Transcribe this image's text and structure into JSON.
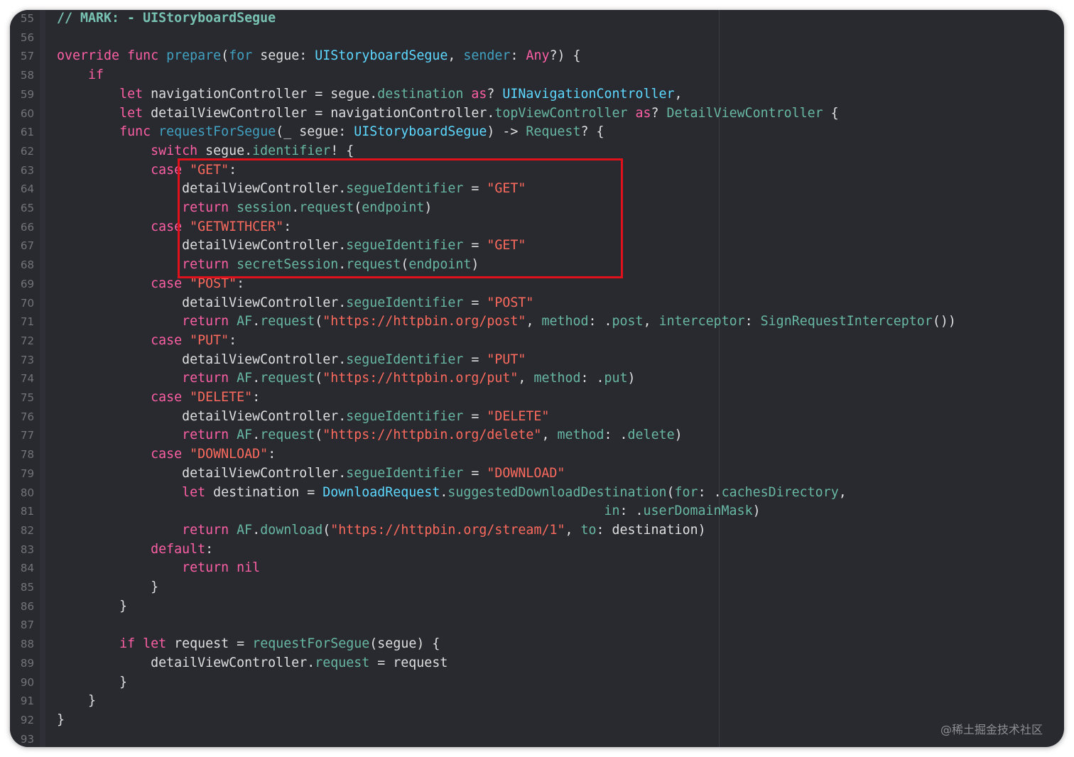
{
  "editor": {
    "line_numbers": [
      "55",
      "56",
      "57",
      "58",
      "59",
      "60",
      "61",
      "62",
      "63",
      "64",
      "65",
      "66",
      "67",
      "68",
      "69",
      "70",
      "71",
      "72",
      "73",
      "74",
      "75",
      "76",
      "77",
      "78",
      "79",
      "80",
      "81",
      "82",
      "83",
      "84",
      "85",
      "86",
      "87",
      "88",
      "89",
      "90",
      "91",
      "92",
      "93"
    ],
    "lines": [
      [
        {
          "t": "// MARK: - UIStoryboardSegue",
          "c": "com-mark"
        }
      ],
      [],
      [
        {
          "t": "override",
          "c": "kw"
        },
        {
          "t": " ",
          "c": ""
        },
        {
          "t": "func",
          "c": "kw"
        },
        {
          "t": " ",
          "c": ""
        },
        {
          "t": "prepare",
          "c": "fn"
        },
        {
          "t": "(",
          "c": ""
        },
        {
          "t": "for",
          "c": "fn"
        },
        {
          "t": " segue: ",
          "c": ""
        },
        {
          "t": "UIStoryboardSegue",
          "c": "ty"
        },
        {
          "t": ", ",
          "c": ""
        },
        {
          "t": "sender",
          "c": "fn"
        },
        {
          "t": ": ",
          "c": ""
        },
        {
          "t": "Any",
          "c": "kw"
        },
        {
          "t": "?) {",
          "c": ""
        }
      ],
      [
        {
          "t": "    ",
          "c": ""
        },
        {
          "t": "if",
          "c": "kw"
        }
      ],
      [
        {
          "t": "        ",
          "c": ""
        },
        {
          "t": "let",
          "c": "kw"
        },
        {
          "t": " navigationController = segue.",
          "c": ""
        },
        {
          "t": "destination",
          "c": "mem"
        },
        {
          "t": " ",
          "c": ""
        },
        {
          "t": "as",
          "c": "kw"
        },
        {
          "t": "? ",
          "c": ""
        },
        {
          "t": "UINavigationController",
          "c": "ty"
        },
        {
          "t": ",",
          "c": ""
        }
      ],
      [
        {
          "t": "        ",
          "c": ""
        },
        {
          "t": "let",
          "c": "kw"
        },
        {
          "t": " detailViewController = navigationController.",
          "c": ""
        },
        {
          "t": "topViewController",
          "c": "mem"
        },
        {
          "t": " ",
          "c": ""
        },
        {
          "t": "as",
          "c": "kw"
        },
        {
          "t": "? ",
          "c": ""
        },
        {
          "t": "DetailViewController",
          "c": "pr"
        },
        {
          "t": " {",
          "c": ""
        }
      ],
      [
        {
          "t": "        ",
          "c": ""
        },
        {
          "t": "func",
          "c": "kw"
        },
        {
          "t": " ",
          "c": ""
        },
        {
          "t": "requestForSegue",
          "c": "fn"
        },
        {
          "t": "(_ segue: ",
          "c": ""
        },
        {
          "t": "UIStoryboardSegue",
          "c": "ty"
        },
        {
          "t": ") -> ",
          "c": ""
        },
        {
          "t": "Request",
          "c": "pr"
        },
        {
          "t": "? {",
          "c": ""
        }
      ],
      [
        {
          "t": "            ",
          "c": ""
        },
        {
          "t": "switch",
          "c": "kw"
        },
        {
          "t": " segue.",
          "c": ""
        },
        {
          "t": "identifier",
          "c": "mem"
        },
        {
          "t": "! {",
          "c": ""
        }
      ],
      [
        {
          "t": "            ",
          "c": ""
        },
        {
          "t": "case",
          "c": "kw"
        },
        {
          "t": " ",
          "c": ""
        },
        {
          "t": "\"GET\"",
          "c": "str"
        },
        {
          "t": ":",
          "c": ""
        }
      ],
      [
        {
          "t": "                detailViewController.",
          "c": ""
        },
        {
          "t": "segueIdentifier",
          "c": "mem"
        },
        {
          "t": " = ",
          "c": ""
        },
        {
          "t": "\"GET\"",
          "c": "str"
        }
      ],
      [
        {
          "t": "                ",
          "c": ""
        },
        {
          "t": "return",
          "c": "kw"
        },
        {
          "t": " ",
          "c": ""
        },
        {
          "t": "session",
          "c": "mem"
        },
        {
          "t": ".",
          "c": ""
        },
        {
          "t": "request",
          "c": "mem"
        },
        {
          "t": "(",
          "c": ""
        },
        {
          "t": "endpoint",
          "c": "mem"
        },
        {
          "t": ")",
          "c": ""
        }
      ],
      [
        {
          "t": "            ",
          "c": ""
        },
        {
          "t": "case",
          "c": "kw"
        },
        {
          "t": " ",
          "c": ""
        },
        {
          "t": "\"GETWITHCER\"",
          "c": "str"
        },
        {
          "t": ":",
          "c": ""
        }
      ],
      [
        {
          "t": "                detailViewController.",
          "c": ""
        },
        {
          "t": "segueIdentifier",
          "c": "mem"
        },
        {
          "t": " = ",
          "c": ""
        },
        {
          "t": "\"GET\"",
          "c": "str"
        }
      ],
      [
        {
          "t": "                ",
          "c": ""
        },
        {
          "t": "return",
          "c": "kw"
        },
        {
          "t": " ",
          "c": ""
        },
        {
          "t": "secretSession",
          "c": "mem"
        },
        {
          "t": ".",
          "c": ""
        },
        {
          "t": "request",
          "c": "mem"
        },
        {
          "t": "(",
          "c": ""
        },
        {
          "t": "endpoint",
          "c": "mem"
        },
        {
          "t": ")",
          "c": ""
        }
      ],
      [
        {
          "t": "            ",
          "c": ""
        },
        {
          "t": "case",
          "c": "kw"
        },
        {
          "t": " ",
          "c": ""
        },
        {
          "t": "\"POST\"",
          "c": "str"
        },
        {
          "t": ":",
          "c": ""
        }
      ],
      [
        {
          "t": "                detailViewController.",
          "c": ""
        },
        {
          "t": "segueIdentifier",
          "c": "mem"
        },
        {
          "t": " = ",
          "c": ""
        },
        {
          "t": "\"POST\"",
          "c": "str"
        }
      ],
      [
        {
          "t": "                ",
          "c": ""
        },
        {
          "t": "return",
          "c": "kw"
        },
        {
          "t": " ",
          "c": ""
        },
        {
          "t": "AF",
          "c": "pr"
        },
        {
          "t": ".",
          "c": ""
        },
        {
          "t": "request",
          "c": "mem"
        },
        {
          "t": "(",
          "c": ""
        },
        {
          "t": "\"https://httpbin.org/post\"",
          "c": "str"
        },
        {
          "t": ", ",
          "c": ""
        },
        {
          "t": "method",
          "c": "mem"
        },
        {
          "t": ": .",
          "c": ""
        },
        {
          "t": "post",
          "c": "mem"
        },
        {
          "t": ", ",
          "c": ""
        },
        {
          "t": "interceptor",
          "c": "mem"
        },
        {
          "t": ": ",
          "c": ""
        },
        {
          "t": "SignRequestInterceptor",
          "c": "pr"
        },
        {
          "t": "())",
          "c": ""
        }
      ],
      [
        {
          "t": "            ",
          "c": ""
        },
        {
          "t": "case",
          "c": "kw"
        },
        {
          "t": " ",
          "c": ""
        },
        {
          "t": "\"PUT\"",
          "c": "str"
        },
        {
          "t": ":",
          "c": ""
        }
      ],
      [
        {
          "t": "                detailViewController.",
          "c": ""
        },
        {
          "t": "segueIdentifier",
          "c": "mem"
        },
        {
          "t": " = ",
          "c": ""
        },
        {
          "t": "\"PUT\"",
          "c": "str"
        }
      ],
      [
        {
          "t": "                ",
          "c": ""
        },
        {
          "t": "return",
          "c": "kw"
        },
        {
          "t": " ",
          "c": ""
        },
        {
          "t": "AF",
          "c": "pr"
        },
        {
          "t": ".",
          "c": ""
        },
        {
          "t": "request",
          "c": "mem"
        },
        {
          "t": "(",
          "c": ""
        },
        {
          "t": "\"https://httpbin.org/put\"",
          "c": "str"
        },
        {
          "t": ", ",
          "c": ""
        },
        {
          "t": "method",
          "c": "mem"
        },
        {
          "t": ": .",
          "c": ""
        },
        {
          "t": "put",
          "c": "mem"
        },
        {
          "t": ")",
          "c": ""
        }
      ],
      [
        {
          "t": "            ",
          "c": ""
        },
        {
          "t": "case",
          "c": "kw"
        },
        {
          "t": " ",
          "c": ""
        },
        {
          "t": "\"DELETE\"",
          "c": "str"
        },
        {
          "t": ":",
          "c": ""
        }
      ],
      [
        {
          "t": "                detailViewController.",
          "c": ""
        },
        {
          "t": "segueIdentifier",
          "c": "mem"
        },
        {
          "t": " = ",
          "c": ""
        },
        {
          "t": "\"DELETE\"",
          "c": "str"
        }
      ],
      [
        {
          "t": "                ",
          "c": ""
        },
        {
          "t": "return",
          "c": "kw"
        },
        {
          "t": " ",
          "c": ""
        },
        {
          "t": "AF",
          "c": "pr"
        },
        {
          "t": ".",
          "c": ""
        },
        {
          "t": "request",
          "c": "mem"
        },
        {
          "t": "(",
          "c": ""
        },
        {
          "t": "\"https://httpbin.org/delete\"",
          "c": "str"
        },
        {
          "t": ", ",
          "c": ""
        },
        {
          "t": "method",
          "c": "mem"
        },
        {
          "t": ": .",
          "c": ""
        },
        {
          "t": "delete",
          "c": "mem"
        },
        {
          "t": ")",
          "c": ""
        }
      ],
      [
        {
          "t": "            ",
          "c": ""
        },
        {
          "t": "case",
          "c": "kw"
        },
        {
          "t": " ",
          "c": ""
        },
        {
          "t": "\"DOWNLOAD\"",
          "c": "str"
        },
        {
          "t": ":",
          "c": ""
        }
      ],
      [
        {
          "t": "                detailViewController.",
          "c": ""
        },
        {
          "t": "segueIdentifier",
          "c": "mem"
        },
        {
          "t": " = ",
          "c": ""
        },
        {
          "t": "\"DOWNLOAD\"",
          "c": "str"
        }
      ],
      [
        {
          "t": "                ",
          "c": ""
        },
        {
          "t": "let",
          "c": "kw"
        },
        {
          "t": " destination = ",
          "c": ""
        },
        {
          "t": "DownloadRequest",
          "c": "ty"
        },
        {
          "t": ".",
          "c": ""
        },
        {
          "t": "suggestedDownloadDestination",
          "c": "mem"
        },
        {
          "t": "(",
          "c": ""
        },
        {
          "t": "for",
          "c": "mem"
        },
        {
          "t": ": .",
          "c": ""
        },
        {
          "t": "cachesDirectory",
          "c": "mem"
        },
        {
          "t": ",",
          "c": ""
        }
      ],
      [
        {
          "t": "                                                                      ",
          "c": ""
        },
        {
          "t": "in",
          "c": "mem"
        },
        {
          "t": ": .",
          "c": ""
        },
        {
          "t": "userDomainMask",
          "c": "mem"
        },
        {
          "t": ")",
          "c": ""
        }
      ],
      [
        {
          "t": "                ",
          "c": ""
        },
        {
          "t": "return",
          "c": "kw"
        },
        {
          "t": " ",
          "c": ""
        },
        {
          "t": "AF",
          "c": "pr"
        },
        {
          "t": ".",
          "c": ""
        },
        {
          "t": "download",
          "c": "mem"
        },
        {
          "t": "(",
          "c": ""
        },
        {
          "t": "\"https://httpbin.org/stream/1\"",
          "c": "str"
        },
        {
          "t": ", ",
          "c": ""
        },
        {
          "t": "to",
          "c": "mem"
        },
        {
          "t": ": destination)",
          "c": ""
        }
      ],
      [
        {
          "t": "            ",
          "c": ""
        },
        {
          "t": "default",
          "c": "kw"
        },
        {
          "t": ":",
          "c": ""
        }
      ],
      [
        {
          "t": "                ",
          "c": ""
        },
        {
          "t": "return",
          "c": "kw"
        },
        {
          "t": " ",
          "c": ""
        },
        {
          "t": "nil",
          "c": "kw"
        }
      ],
      [
        {
          "t": "            }",
          "c": ""
        }
      ],
      [
        {
          "t": "        }",
          "c": ""
        }
      ],
      [],
      [
        {
          "t": "        ",
          "c": ""
        },
        {
          "t": "if",
          "c": "kw"
        },
        {
          "t": " ",
          "c": ""
        },
        {
          "t": "let",
          "c": "kw"
        },
        {
          "t": " request = ",
          "c": ""
        },
        {
          "t": "requestForSegue",
          "c": "mem"
        },
        {
          "t": "(segue) {",
          "c": ""
        }
      ],
      [
        {
          "t": "            detailViewController.",
          "c": ""
        },
        {
          "t": "request",
          "c": "mem"
        },
        {
          "t": " = request",
          "c": ""
        }
      ],
      [
        {
          "t": "        }",
          "c": ""
        }
      ],
      [
        {
          "t": "    }",
          "c": ""
        }
      ],
      [
        {
          "t": "}",
          "c": ""
        }
      ],
      []
    ]
  },
  "colors": {
    "background": "#292a30",
    "keyword": "#fc5fa3",
    "string": "#fc6a5d",
    "type": "#5dd8ff",
    "member": "#67b7a4",
    "highlight_box": "#e1111c"
  },
  "watermark": "@稀土掘金技术社区"
}
